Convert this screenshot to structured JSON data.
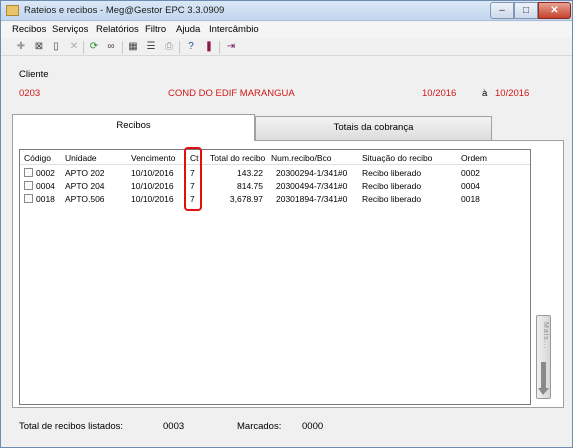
{
  "window": {
    "title": "Rateios e recibos - Meg@Gestor EPC 3.3.0909",
    "minimize": "–",
    "maximize": "□",
    "close": "✕"
  },
  "menu": [
    "Recibos",
    "Serviços",
    "Relatórios",
    "Filtro",
    "Ajuda",
    "Intercâmbio"
  ],
  "toolbar_icons": [
    "add-icon",
    "delete-icon",
    "document-icon",
    "cancel-icon",
    "refresh-icon",
    "binoculars-icon",
    "grid-icon",
    "list-icon",
    "print-icon",
    "help-icon",
    "books-icon",
    "exit-icon"
  ],
  "client": {
    "label": "Cliente",
    "code": "0203",
    "name": "COND DO EDIF MARANGUA",
    "date_from": "10/2016",
    "separator": "à",
    "date_to": "10/2016"
  },
  "tabs": [
    {
      "label": "Recibos",
      "active": true
    },
    {
      "label": "Totais da cobrança",
      "active": false
    }
  ],
  "table": {
    "columns": [
      "Código",
      "Unidade",
      "Vencimento",
      "Ct",
      "Total do recibo",
      "Num.recibo/Bco",
      "Situação do recibo",
      "Ordem"
    ],
    "rows": [
      {
        "codigo": "0002",
        "unidade": "APTO 202",
        "vencimento": "10/10/2016",
        "ct": "7",
        "total": "143.22",
        "num": "20300294-1/341#0",
        "situacao": "Recibo liberado",
        "ordem": "0002"
      },
      {
        "codigo": "0004",
        "unidade": "APTO 204",
        "vencimento": "10/10/2016",
        "ct": "7",
        "total": "814.75",
        "num": "20300494-7/341#0",
        "situacao": "Recibo liberado",
        "ordem": "0004"
      },
      {
        "codigo": "0018",
        "unidade": "APTO.506",
        "vencimento": "10/10/2016",
        "ct": "7",
        "total": "3,678.97",
        "num": "20301894-7/341#0",
        "situacao": "Recibo liberado",
        "ordem": "0018"
      }
    ]
  },
  "mais_button": "Mais...",
  "footer": {
    "listed_label": "Total de recibos listados:",
    "listed_value": "0003",
    "marked_label": "Marcados:",
    "marked_value": "0000"
  },
  "colors": {
    "highlight": "#e01010",
    "client_text": "#d01818"
  }
}
